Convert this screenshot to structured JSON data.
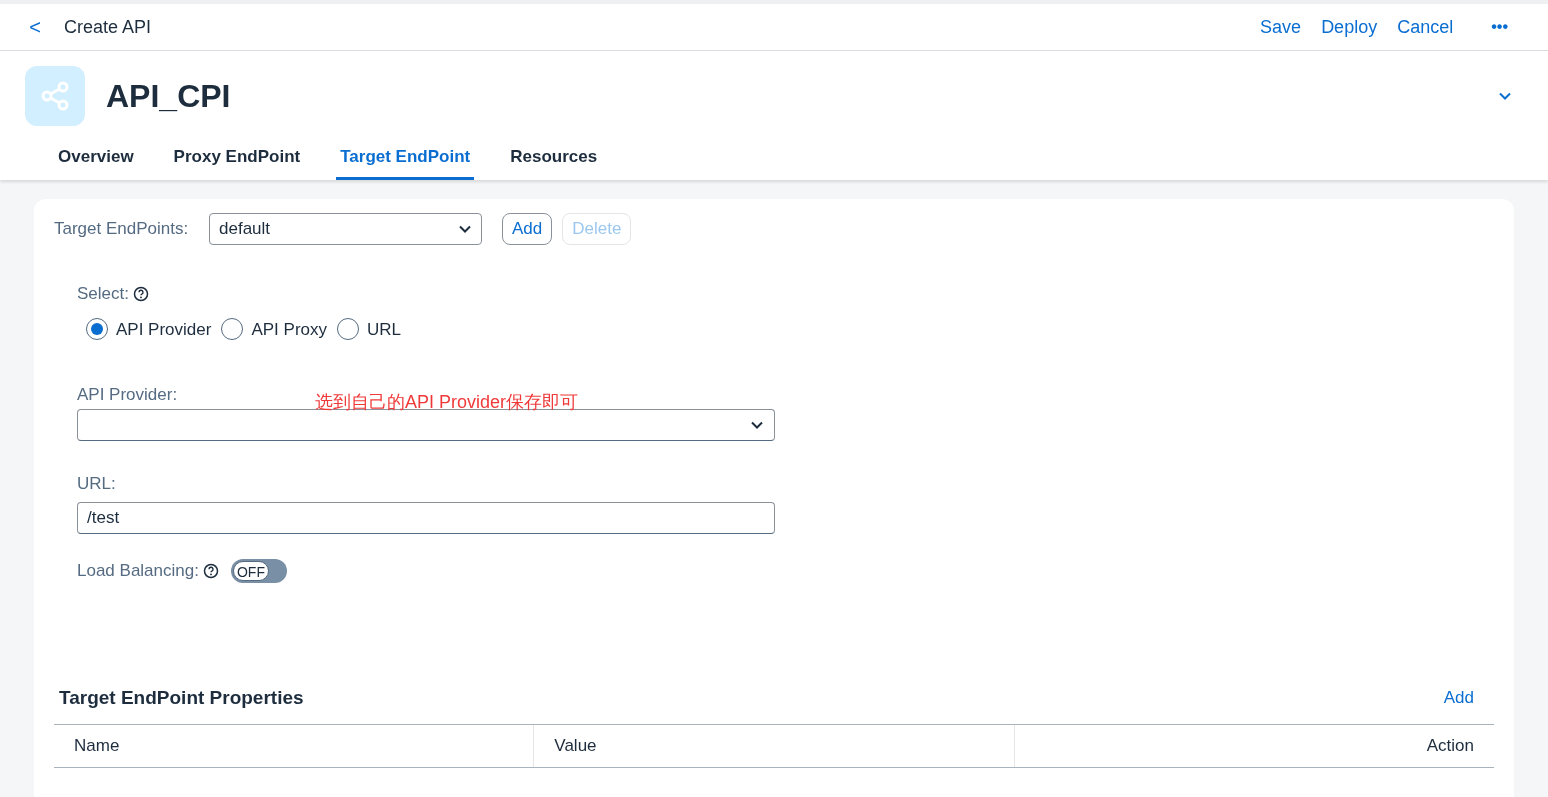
{
  "shell_bar": {
    "back": "<",
    "title": "Create API",
    "actions": [
      "Save",
      "Deploy",
      "Cancel"
    ],
    "overflow": "•••"
  },
  "header": {
    "title": "API_CPI",
    "expanded": false
  },
  "tabs": [
    {
      "label": "Overview",
      "selected": false
    },
    {
      "label": "Proxy EndPoint",
      "selected": false
    },
    {
      "label": "Target EndPoint",
      "selected": true
    },
    {
      "label": "Resources",
      "selected": false
    }
  ],
  "endpoints": {
    "label": "Target EndPoints:",
    "value": "default",
    "buttons": [
      {
        "label": "Add",
        "disabled": false
      },
      {
        "label": "Delete",
        "disabled": true
      }
    ]
  },
  "select": {
    "label": "Select:",
    "options": [
      {
        "label": "API Provider",
        "selected": true
      },
      {
        "label": "API Proxy",
        "selected": false
      },
      {
        "label": "URL",
        "selected": false
      }
    ]
  },
  "api_provider": {
    "label": "API Provider:",
    "annotation": "选到自己的API Provider保存即可"
  },
  "url": {
    "label": "URL:",
    "value": "/test"
  },
  "load_balancing": {
    "label": "Load Balancing:",
    "on": false,
    "state_text": "OFF"
  },
  "properties": {
    "title": "Target EndPoint Properties",
    "add": "Add",
    "columns": [
      "Name",
      "Value",
      "Action"
    ]
  }
}
